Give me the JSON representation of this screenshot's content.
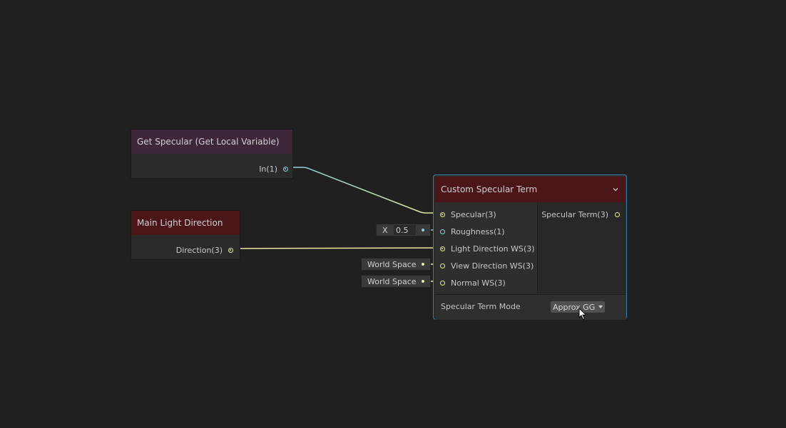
{
  "graph": {
    "nodes": {
      "get_specular": {
        "title": "Get Specular (Get Local Variable)",
        "output_label": "In(1)"
      },
      "main_light": {
        "title": "Main Light Direction",
        "output_label": "Direction(3)"
      },
      "custom_specular": {
        "title": "Custom Specular Term",
        "inputs": [
          "Specular(3)",
          "Roughness(1)",
          "Light Direction WS(3)",
          "View Direction WS(3)",
          "Normal WS(3)"
        ],
        "output_label": "Specular Term(3)",
        "mode_label": "Specular Term Mode",
        "mode_value": "Approx GGX"
      }
    },
    "inline_inputs": {
      "roughness_axis": "X",
      "roughness_value": "0.5",
      "view_space": "World Space",
      "normal_space": "World Space"
    }
  },
  "colors": {
    "vector3_port": "#e9ea9a",
    "float_port": "#88d1e0",
    "selection_border": "#3b7fa6",
    "node_title_red": "#4a1618",
    "node_title_local": "#3d2739"
  },
  "icons": [
    "chevron-down-icon",
    "dropdown-caret-icon",
    "mouse-cursor-icon"
  ]
}
